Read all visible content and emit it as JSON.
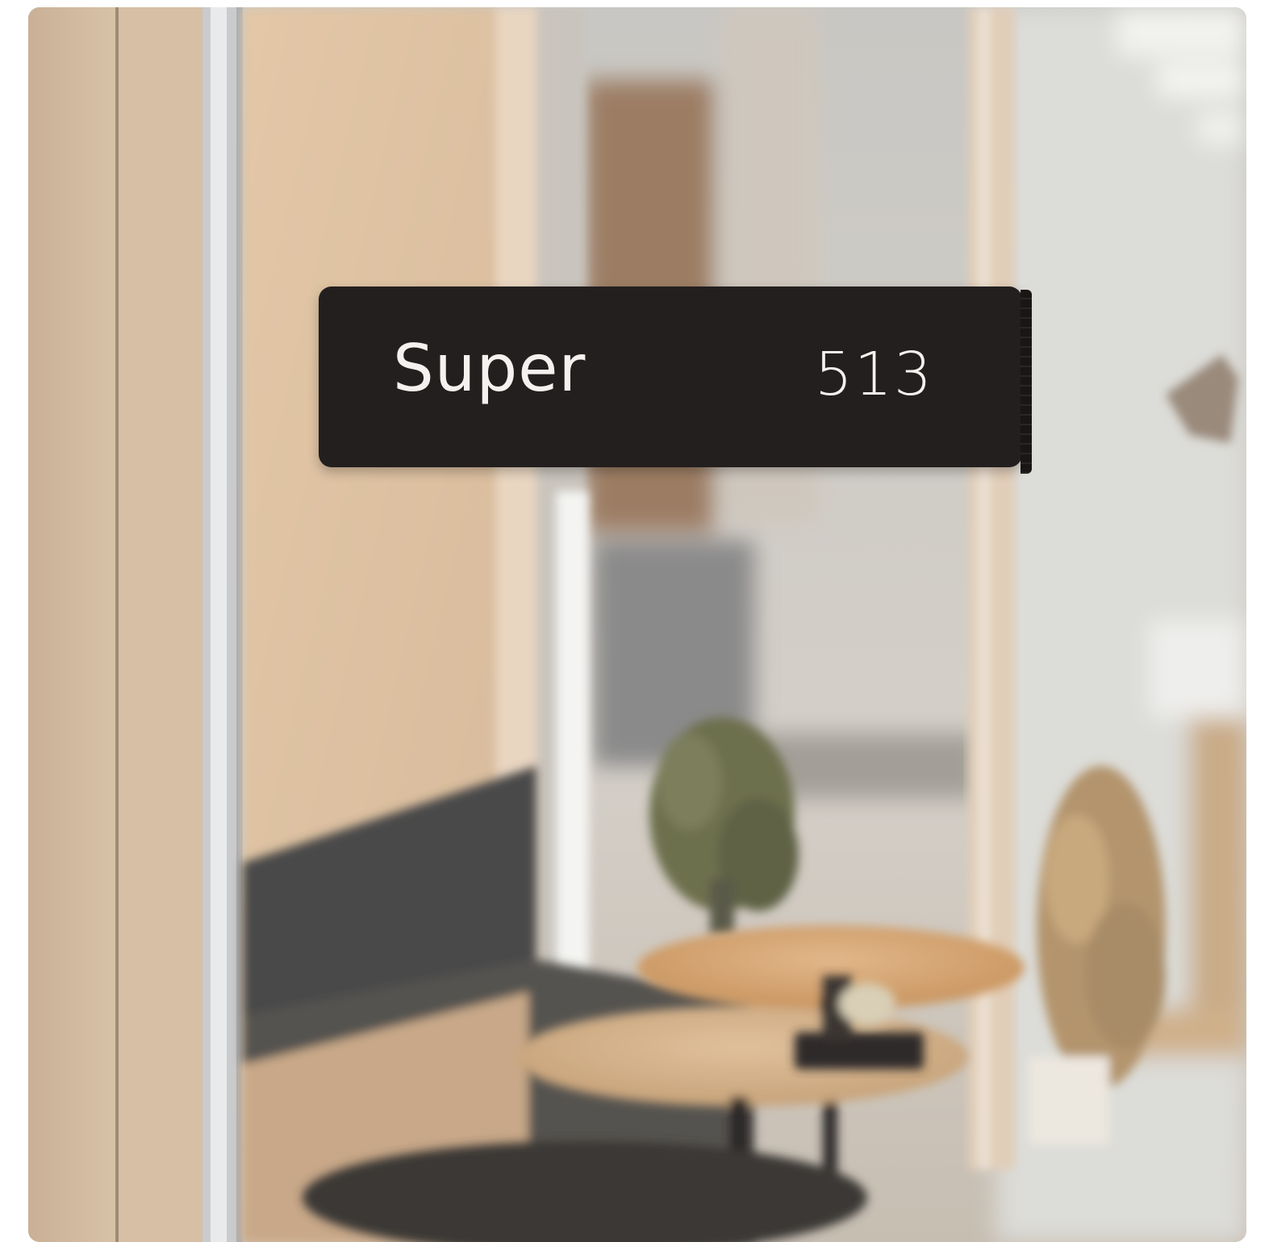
{
  "image": {
    "description_free": true,
    "sign": {
      "name": "Super",
      "number": "513"
    },
    "colors": {
      "sign_background": "#231f1f",
      "sign_text": "#f4f1ee",
      "wall_wood": "#d9bea0",
      "door_frame": "#cfc8c0"
    }
  }
}
